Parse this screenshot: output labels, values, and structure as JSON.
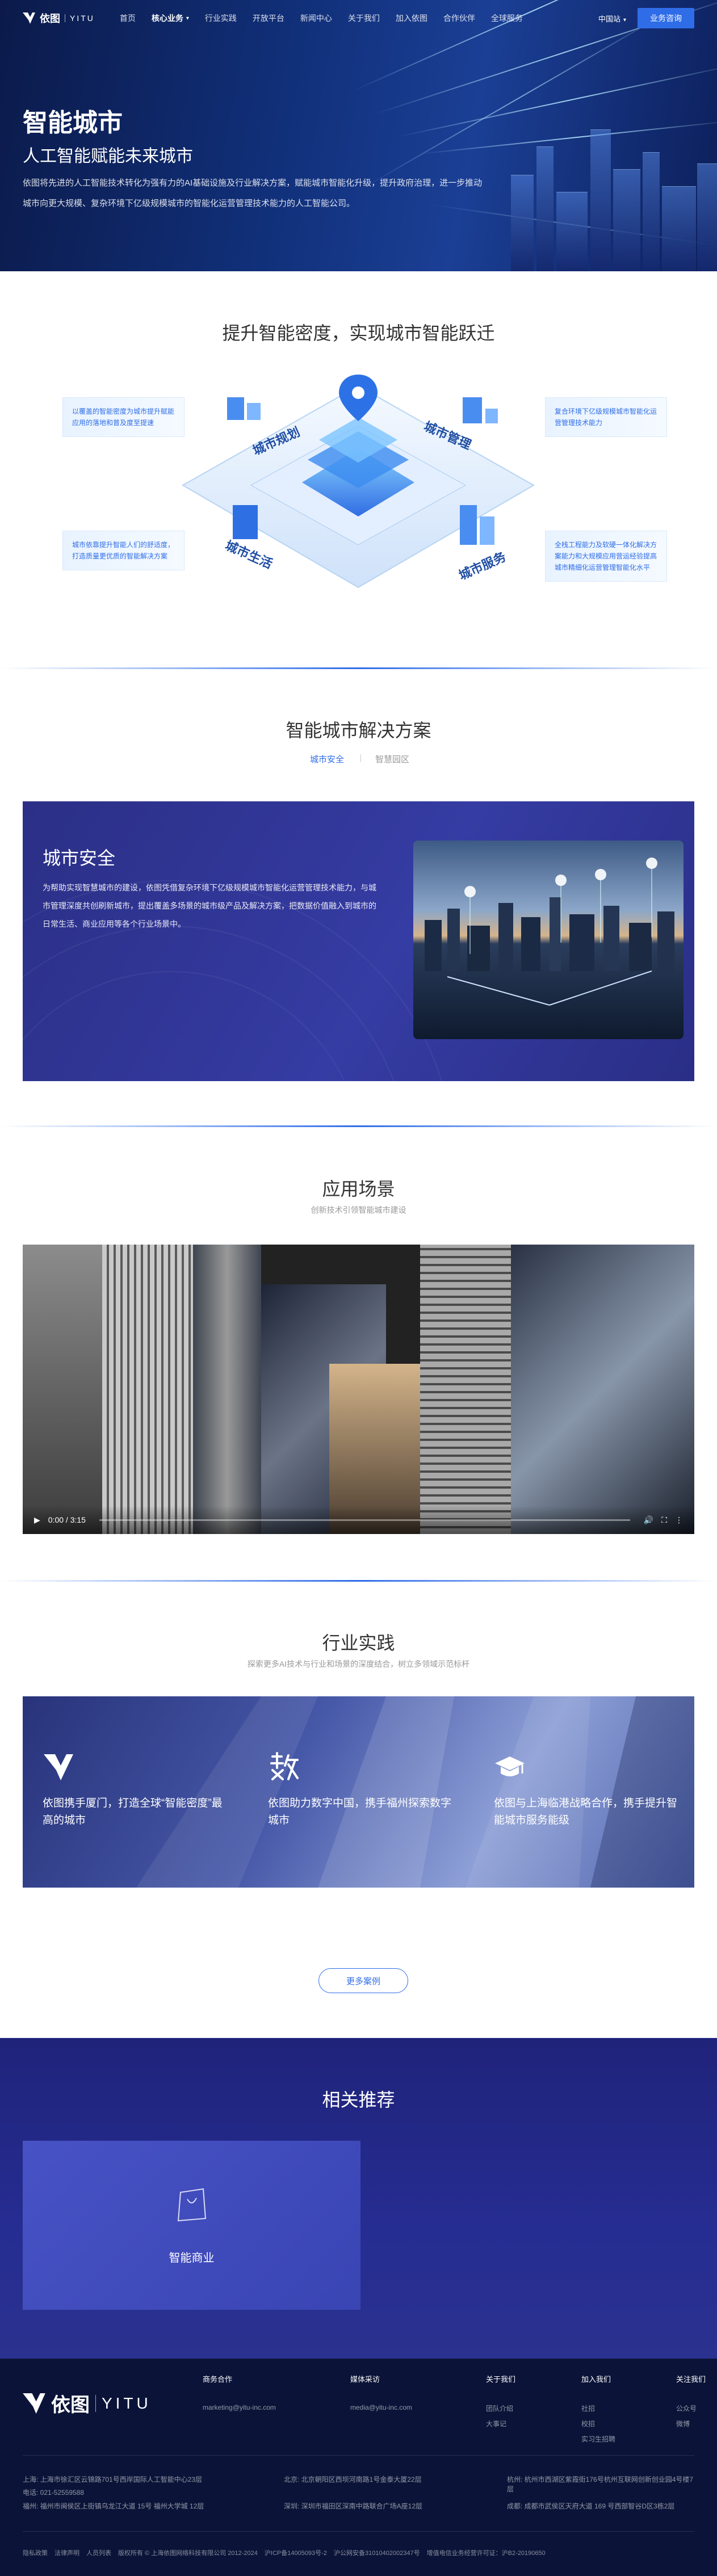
{
  "brand": {
    "cn": "依图",
    "en": "YITU"
  },
  "nav": {
    "items": [
      "首页",
      "核心业务",
      "行业实践",
      "开放平台",
      "新闻中心",
      "关于我们",
      "加入依图",
      "合作伙伴",
      "全球服务"
    ],
    "language": "中国站",
    "contact": "业务咨询"
  },
  "hero": {
    "title": "智能城市",
    "subtitle": "人工智能赋能未来城市",
    "description": "依图将先进的人工智能技术转化为强有力的AI基础设施及行业解决方案，赋能城市智能化升级，提升政府治理，进一步推动城市向更大规模、复杂环境下亿级规模城市的智能化运营管理技术能力的人工智能公司。"
  },
  "density": {
    "title": "提升智能密度，实现城市智能跃迁",
    "notes": [
      "以覆盖的智能密度为城市提升赋能应用的落地和普及度至提速",
      "复合环境下亿级规模城市智能化运营管理技术能力",
      "城市依靠提升智能人们的舒适度，打造质量更优质的智能解决方案",
      "全栈工程能力及软硬一体化解决方案能力和大规模应用营运经验提高城市精细化运营管理智能化水平"
    ],
    "blocks": [
      "城市规划",
      "城市管理",
      "城市生活",
      "城市服务"
    ]
  },
  "solutions": {
    "title": "智能城市解决方案",
    "tabs": [
      "城市安全",
      "智慧园区"
    ],
    "active_tab": "城市安全",
    "panel_title": "城市安全",
    "panel_desc": "为帮助实现智慧城市的建设，依图凭借复杂环境下亿级规模城市智能化运营管理技术能力，与城市管理深度共创刷新城市，提出覆盖多场景的城市级产品及解决方案，把数据价值融入到城市的日常生活、商业应用等各个行业场景中。"
  },
  "scenes": {
    "title": "应用场景",
    "subtitle": "创新技术引领智能城市建设",
    "video": {
      "time": "0:00 / 3:15"
    }
  },
  "practice": {
    "title": "行业实践",
    "subtitle": "探索更多AI技术与行业和场景的深度结合，树立多领域示范标杆",
    "items": [
      {
        "text": "依图携手厦门，打造全球“智能密度”最高的城市",
        "icon": "yitu-logo-icon"
      },
      {
        "text": "依图助力数字中国，携手福州探索数字城市",
        "icon": "shu-calligraphy-icon"
      },
      {
        "text": "依图与上海临港战略合作，携手提升智能城市服务能级",
        "icon": "graduation-cap-icon"
      }
    ],
    "more": "更多案例"
  },
  "recommend": {
    "title": "相关推荐",
    "card": {
      "label": "智能商业",
      "icon": "shopping-bag-icon"
    }
  },
  "footer": {
    "columns": [
      {
        "head": "商务合作",
        "items": [
          "marketing@yitu-inc.com"
        ]
      },
      {
        "head": "媒体采访",
        "items": [
          "media@yitu-inc.com"
        ]
      },
      {
        "head": "关于我们",
        "items": [
          "团队介绍",
          "大事记"
        ]
      },
      {
        "head": "加入我们",
        "items": [
          "社招",
          "校招",
          "实习生招聘"
        ]
      },
      {
        "head": "关注我们",
        "items": [
          "公众号",
          "微博"
        ]
      }
    ],
    "addresses": [
      "上海: 上海市徐汇区云锦路701号西岸国际人工智能中心23层",
      "北京: 北京朝阳区西坝河南路1号金泰大厦22层",
      "杭州: 杭州市西湖区紫霞街176号杭州互联网创新创业园4号楼7层",
      "电话: 021-52559588",
      "深圳: 深圳市福田区深南中路联合广场A座12层",
      "成都: 成都市武侯区天府大道 169 号西部智谷D区3栋2层",
      "福州: 福州市闽侯区上街镇乌龙江大道 15号 福州大学城 12层"
    ],
    "legal": [
      "隐私政策",
      "法律声明",
      "人员列表",
      "版权所有 © 上海依图网络科技有限公司 2012-2024",
      "沪ICP备14005093号-2",
      "沪公网安备31010402002347号",
      "增值电信业务经营许可证：沪B2-20190650"
    ]
  },
  "colors": {
    "accent": "#2f6de8",
    "dark_navy": "#0b1438",
    "panel": "#2b2f86"
  }
}
